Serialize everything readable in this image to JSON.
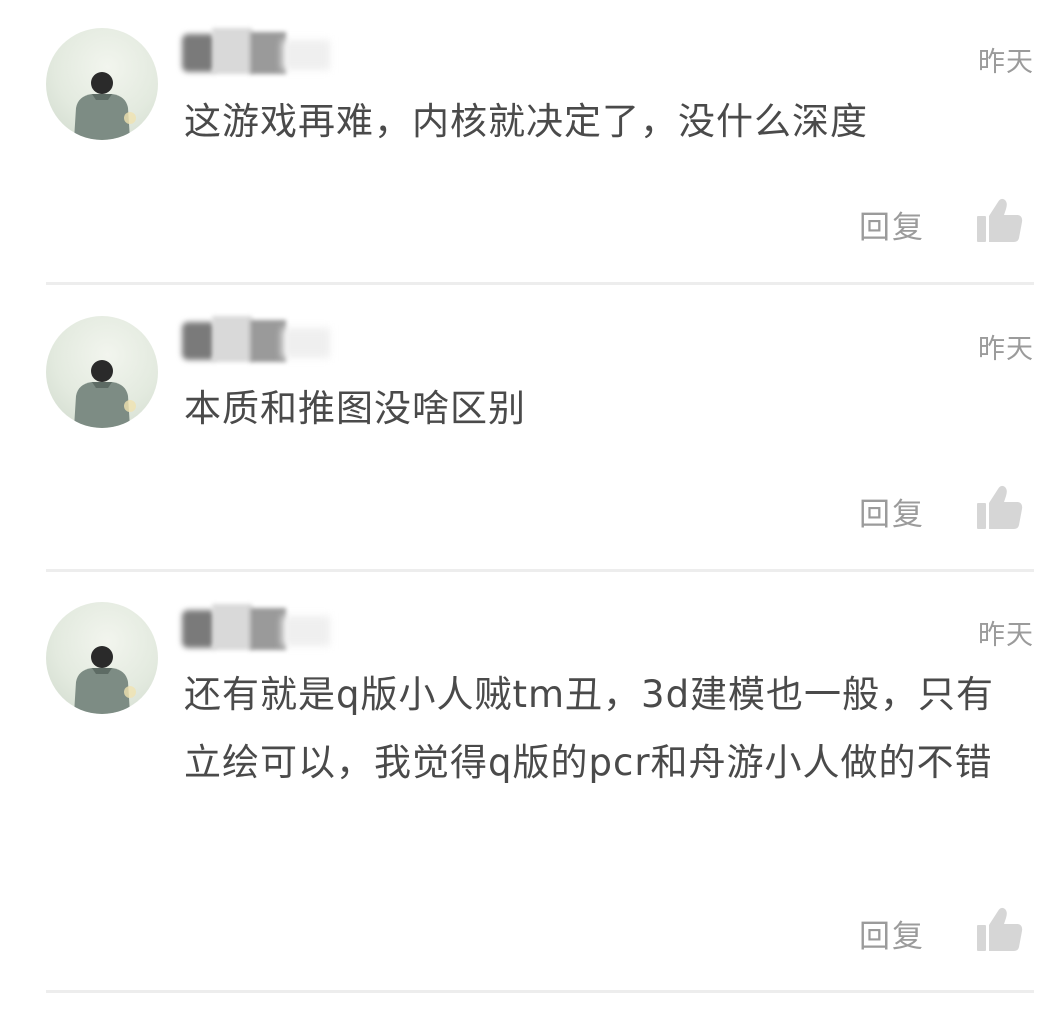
{
  "comments": [
    {
      "time": "昨天",
      "text": "这游戏再难，内核就决定了，没什么深度",
      "reply_label": "回复",
      "avatar_icon": "person-back-avatar",
      "like_icon": "thumbs-up-icon"
    },
    {
      "time": "昨天",
      "text": "本质和推图没啥区别",
      "reply_label": "回复",
      "avatar_icon": "person-back-avatar",
      "like_icon": "thumbs-up-icon"
    },
    {
      "time": "昨天",
      "text": "还有就是q版小人贼tm丑，3d建模也一般，只有立绘可以，我觉得q版的pcr和舟游小人做的不错",
      "reply_label": "回复",
      "avatar_icon": "person-back-avatar",
      "like_icon": "thumbs-up-icon"
    }
  ],
  "colors": {
    "text": "#4a4a4a",
    "muted": "#9b9b9b",
    "divider": "#ededed",
    "like_icon": "#d6d6d6"
  }
}
